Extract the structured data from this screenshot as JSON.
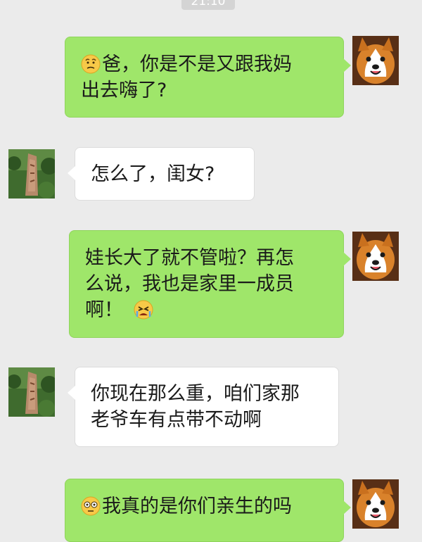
{
  "status": {
    "time": "21:10"
  },
  "messages": [
    {
      "sender": "me",
      "avatar": "corgi-avatar",
      "lead_emoji": "confused-face-icon",
      "lines": [
        "爸，你是不是又跟我妈",
        "出去嗨了?"
      ]
    },
    {
      "sender": "dad",
      "avatar": "stone-landscape-avatar",
      "lines": [
        "怎么了，闺女?"
      ]
    },
    {
      "sender": "me",
      "avatar": "corgi-avatar",
      "lines": [
        "娃长大了就不管啦？再怎",
        "么说，我也是家里一成员",
        "啊！"
      ],
      "trail_emoji": "crying-face-icon"
    },
    {
      "sender": "dad",
      "avatar": "stone-landscape-avatar",
      "lines": [
        "你现在那么重，咱们家那",
        "老爷车有点带不动啊"
      ]
    },
    {
      "sender": "me",
      "avatar": "corgi-avatar",
      "lead_emoji": "sweat-face-icon",
      "lines": [
        "我真的是你们亲生的吗"
      ]
    }
  ],
  "colors": {
    "background": "#ebebeb",
    "my_bubble": "#9fe66a",
    "other_bubble": "#ffffff",
    "text": "#1a1a1a"
  }
}
